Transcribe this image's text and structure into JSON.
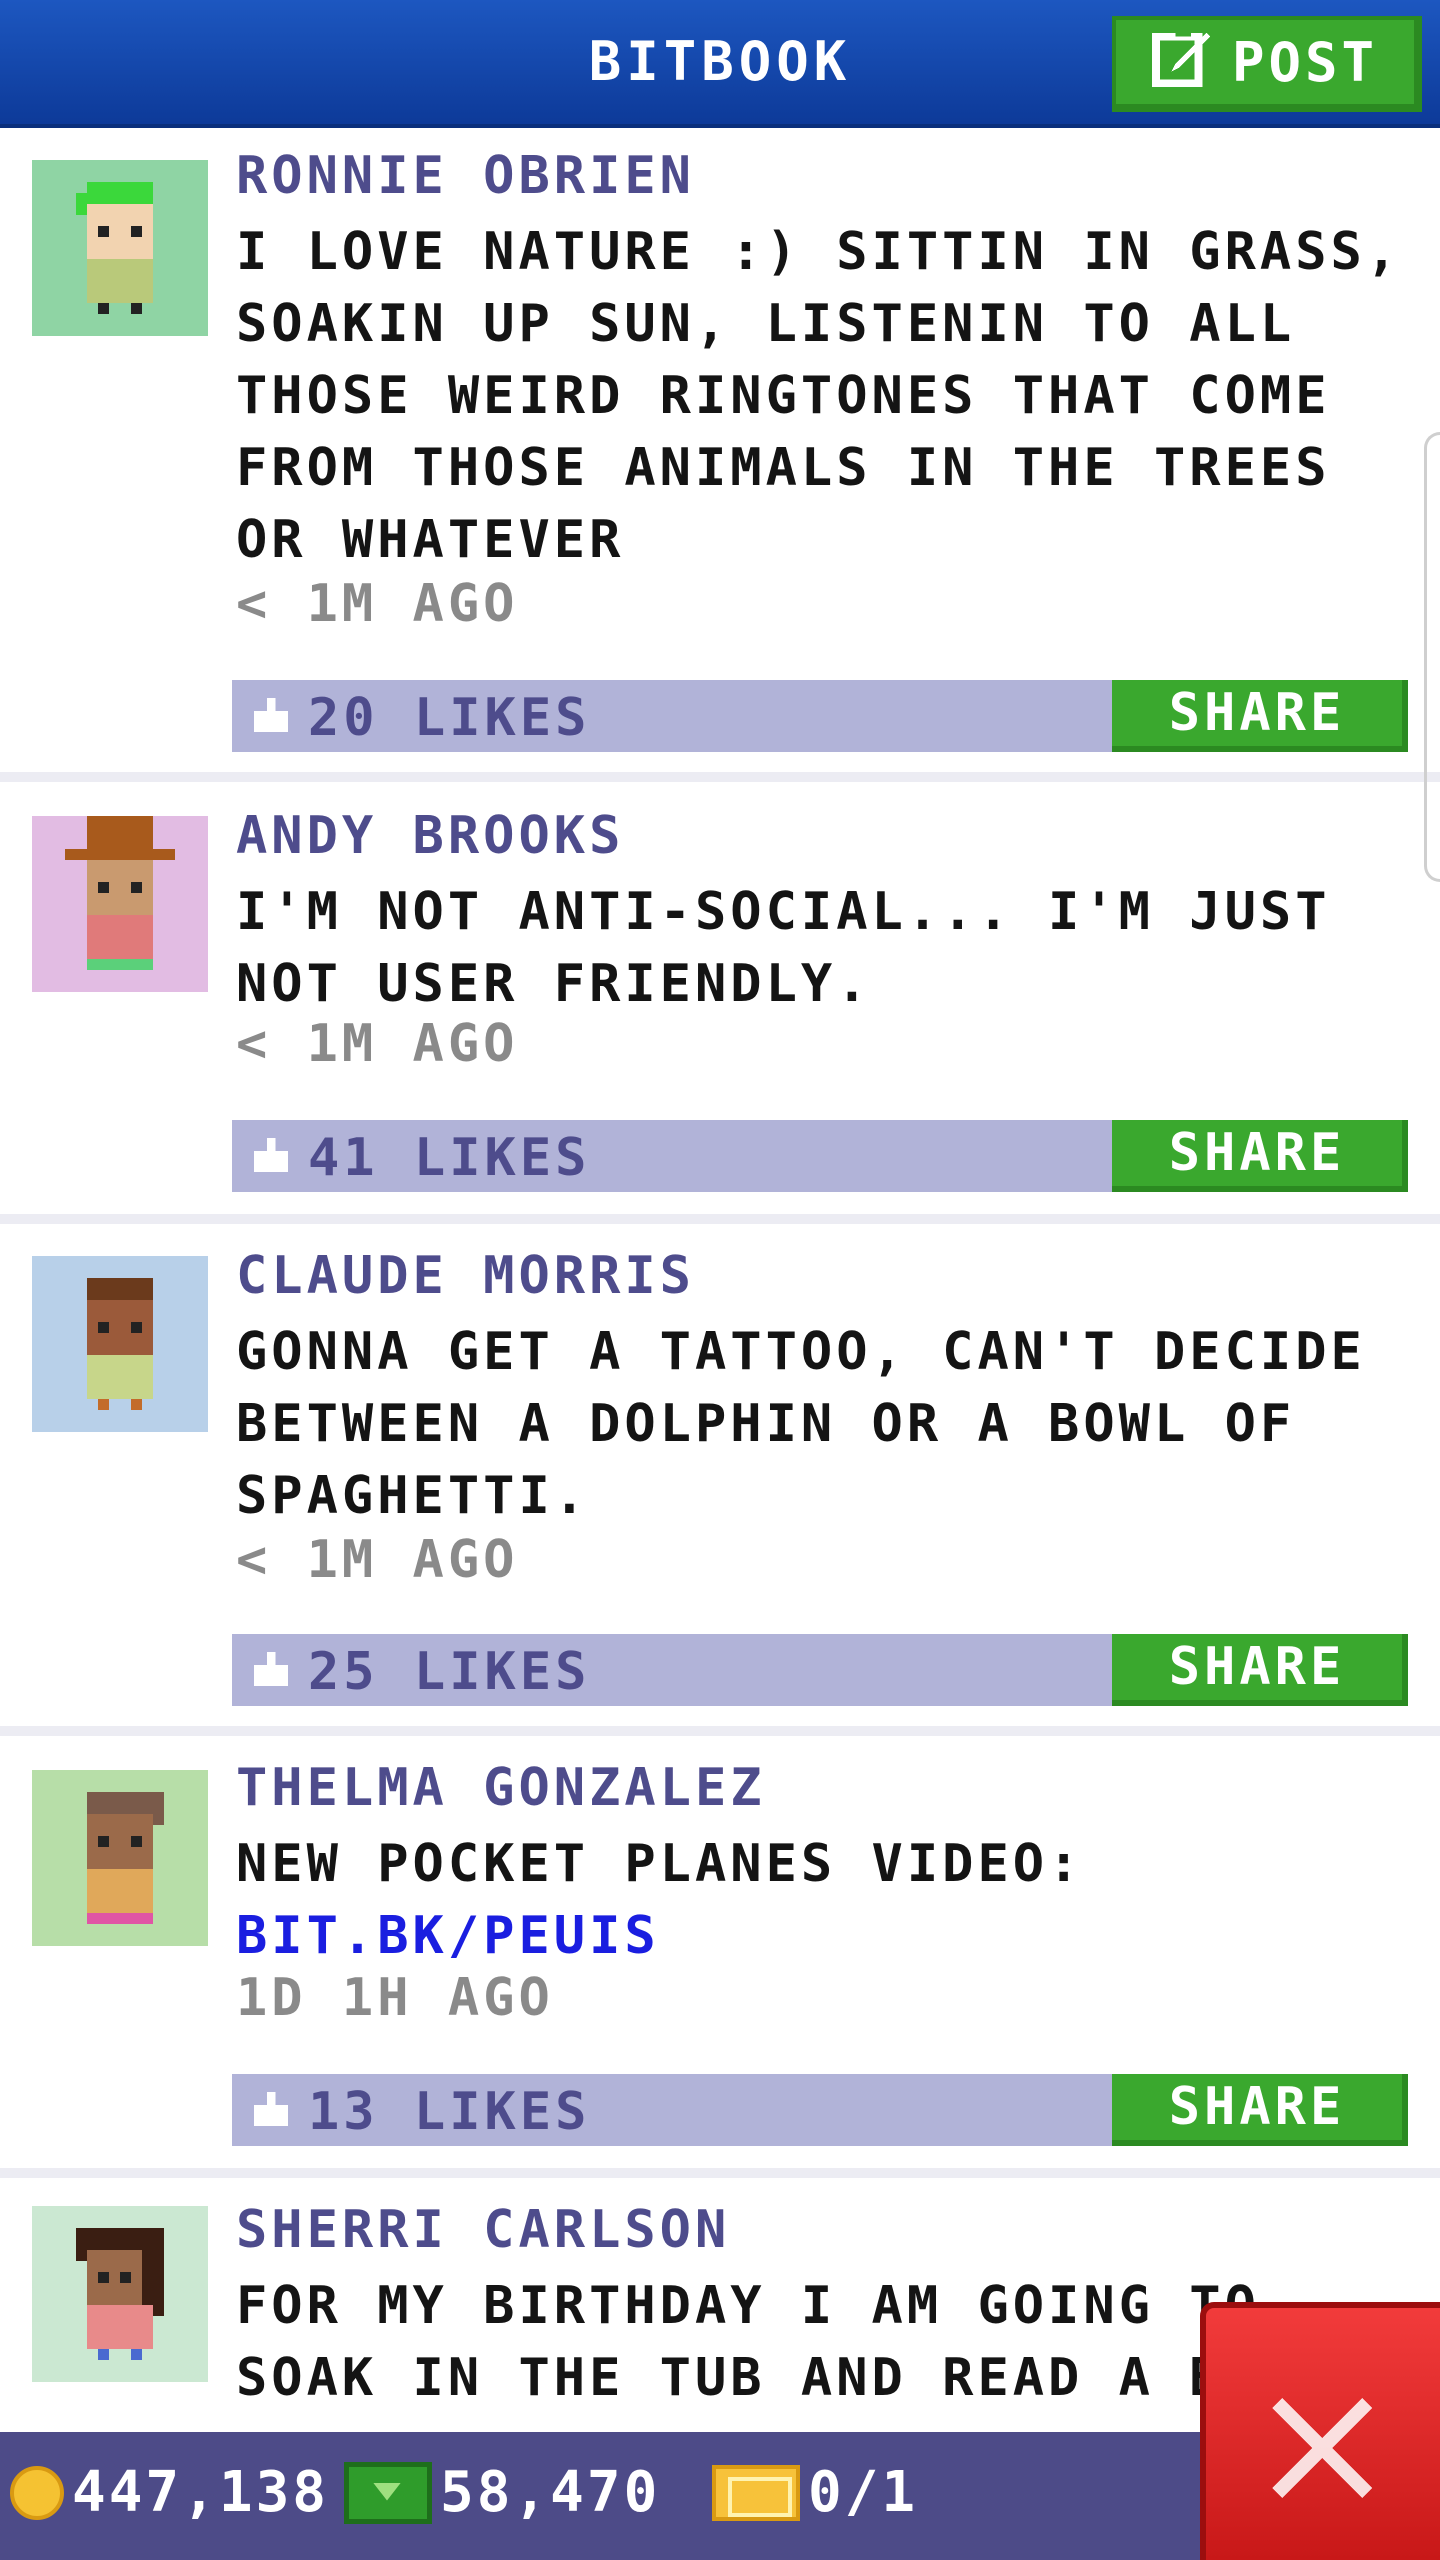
{
  "header": {
    "title": "BITBOOK",
    "post_label": "POST",
    "post_icon": "edit-icon"
  },
  "posts": [
    {
      "name": "RONNIE OBRIEN",
      "message": "I LOVE NATURE :) SITTIN IN GRASS, SOAKIN UP SUN, LISTENIN TO ALL THOSE WEIRD RINGTONES THAT COME FROM THOSE ANIMALS IN THE TREES OR WHATEVER",
      "time": "< 1M AGO",
      "likes": "20 LIKES",
      "share_label": "SHARE",
      "avatar_bg": "#8fd4a4"
    },
    {
      "name": "ANDY BROOKS",
      "message": "I'M NOT ANTI-SOCIAL... I'M JUST NOT USER FRIENDLY.",
      "time": "< 1M AGO",
      "likes": "41 LIKES",
      "share_label": "SHARE",
      "avatar_bg": "#e2bce3"
    },
    {
      "name": "CLAUDE MORRIS",
      "message": "GONNA GET A TATTOO, CAN'T DECIDE BETWEEN A DOLPHIN OR A BOWL OF SPAGHETTI.",
      "time": "< 1M AGO",
      "likes": "25 LIKES",
      "share_label": "SHARE",
      "avatar_bg": "#b8d0e9"
    },
    {
      "name": "THELMA GONZALEZ",
      "message": "NEW POCKET PLANES VIDEO:",
      "link": "BIT.BK/PEUIS",
      "time": "1D 1H AGO",
      "likes": "13 LIKES",
      "share_label": "SHARE",
      "avatar_bg": "#b7dea8"
    },
    {
      "name": "SHERRI CARLSON",
      "message": "FOR MY BIRTHDAY I AM GOING TO SOAK IN THE TUB AND READ A B",
      "avatar_bg": "#cbe8d2"
    }
  ],
  "footer": {
    "coins": "447,138",
    "cash": "58,470",
    "tickets": "0/1"
  },
  "colors": {
    "header": "#1d57c0",
    "accent_green": "#3aa82e",
    "likes_bar": "#b1b3d8",
    "name_text": "#4e4c8c",
    "close_red": "#e02626",
    "footer": "#4d4b88"
  }
}
